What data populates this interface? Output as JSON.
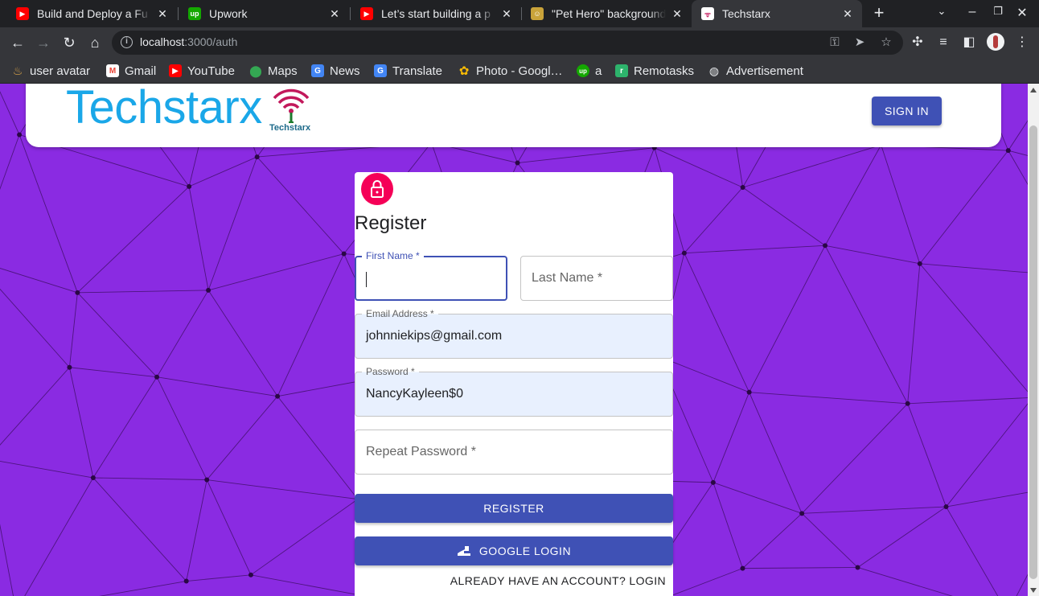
{
  "browser": {
    "tabs": [
      {
        "title": "Build and Deploy a Fu",
        "icon": "youtube-icon"
      },
      {
        "title": "Upwork",
        "icon": "upwork-icon"
      },
      {
        "title": "Let’s start building a p",
        "icon": "youtube-icon"
      },
      {
        "title": "\"Pet Hero\" background",
        "icon": "pet-hero-icon"
      },
      {
        "title": "Techstarx",
        "icon": "techstarx-icon",
        "active": true
      }
    ],
    "url_host": "localhost",
    "url_path": ":3000/auth",
    "bookmarks": [
      {
        "label": "user avatar",
        "icon": "user-avatar-icon"
      },
      {
        "label": "Gmail",
        "icon": "gmail-icon"
      },
      {
        "label": "YouTube",
        "icon": "youtube-icon"
      },
      {
        "label": "Maps",
        "icon": "maps-icon"
      },
      {
        "label": "News",
        "icon": "news-icon"
      },
      {
        "label": "Translate",
        "icon": "translate-icon"
      },
      {
        "label": "Photo - Googl…",
        "icon": "photos-icon"
      },
      {
        "label": "a",
        "icon": "upwork-icon"
      },
      {
        "label": "Remotasks",
        "icon": "remotasks-icon"
      },
      {
        "label": "Advertisement",
        "icon": "globe-icon"
      }
    ]
  },
  "header": {
    "logo_text": "Techstarx",
    "logo_subtext": "Techstarx",
    "signin_label": "SIGN IN"
  },
  "form": {
    "title": "Register",
    "first_name": {
      "label": "First Name *",
      "value": ""
    },
    "last_name": {
      "label": "Last Name *",
      "placeholder": "Last Name *"
    },
    "email": {
      "label": "Email Address *",
      "value": "johnniekips@gmail.com"
    },
    "password": {
      "label": "Password *",
      "value": "NancyKayleen$0"
    },
    "repeat_password": {
      "label": "Repeat Password *",
      "placeholder": "Repeat Password *"
    },
    "register_label": "REGISTER",
    "google_label": "GOOGLE LOGIN",
    "login_link": "ALREADY HAVE AN ACCOUNT? LOGIN"
  },
  "colors": {
    "page_background": "#8a2be2",
    "primary": "#3f51b5",
    "avatar": "#f50057",
    "logo": "#1aa7e8",
    "autofill": "#e8f0fe"
  }
}
